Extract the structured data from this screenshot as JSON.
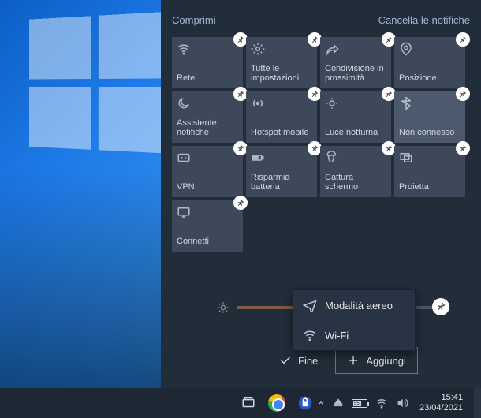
{
  "header": {
    "collapse": "Comprimi",
    "clear": "Cancella le notifiche"
  },
  "tiles": [
    {
      "icon": "wifi-icon",
      "label": "Rete"
    },
    {
      "icon": "gear-icon",
      "label": "Tutte le impostazioni"
    },
    {
      "icon": "share-icon",
      "label": "Condivisione in prossimità"
    },
    {
      "icon": "location-icon",
      "label": "Posizione"
    },
    {
      "icon": "moon-icon",
      "label": "Assistente notifiche"
    },
    {
      "icon": "hotspot-icon",
      "label": "Hotspot mobile"
    },
    {
      "icon": "nightlight-icon",
      "label": "Luce notturna"
    },
    {
      "icon": "bluetooth-icon",
      "label": "Non connesso",
      "highlight": true
    },
    {
      "icon": "vpn-icon",
      "label": "VPN"
    },
    {
      "icon": "battery-icon",
      "label": "Risparmia batteria"
    },
    {
      "icon": "screenshot-icon",
      "label": "Cattura schermo"
    },
    {
      "icon": "project-icon",
      "label": "Proietta"
    },
    {
      "icon": "connect-icon",
      "label": "Connetti"
    }
  ],
  "context_menu": {
    "items": [
      {
        "icon": "airplane-icon",
        "label": "Modalità aereo"
      },
      {
        "icon": "wifi-icon",
        "label": "Wi-Fi"
      }
    ]
  },
  "bottom": {
    "done": "Fine",
    "add": "Aggiungi"
  },
  "taskbar": {
    "battery_label": "55",
    "time": "15:41",
    "date": "23/04/2021"
  }
}
